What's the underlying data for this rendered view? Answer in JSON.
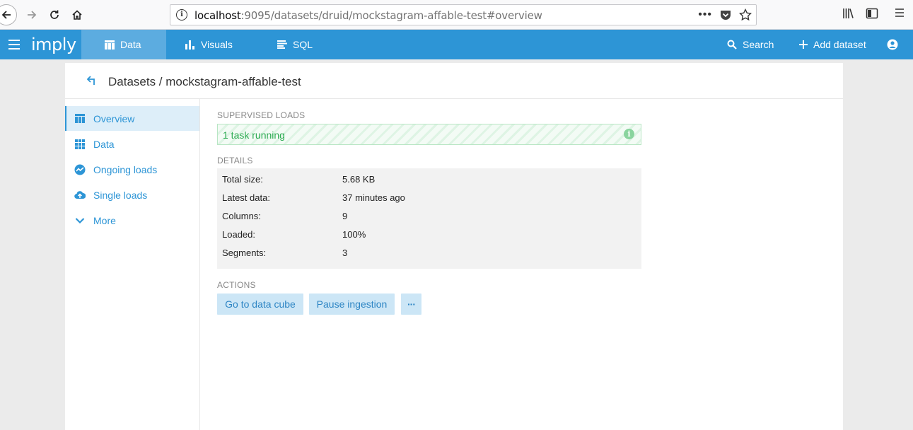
{
  "browser": {
    "url_host": "localhost",
    "url_path": ":9095/datasets/druid/mockstagram-affable-test#overview",
    "info_glyph": "i"
  },
  "header": {
    "logo": "imply",
    "tabs": [
      {
        "label": "Data",
        "icon": "table-icon",
        "active": true
      },
      {
        "label": "Visuals",
        "icon": "bar-chart-icon",
        "active": false
      },
      {
        "label": "SQL",
        "icon": "sql-icon",
        "active": false
      }
    ],
    "search_label": "Search",
    "add_dataset_label": "Add dataset",
    "colors": {
      "bar": "#2d95d6",
      "active_tab": "#5cace0"
    }
  },
  "page": {
    "breadcrumb": "Datasets / mockstagram-affable-test"
  },
  "sidebar": {
    "items": [
      {
        "label": "Overview",
        "icon": "table-icon",
        "active": true
      },
      {
        "label": "Data",
        "icon": "grid-icon",
        "active": false
      },
      {
        "label": "Ongoing loads",
        "icon": "pulse-icon",
        "active": false
      },
      {
        "label": "Single loads",
        "icon": "cloud-upload-icon",
        "active": false
      },
      {
        "label": "More",
        "icon": "chevron-down-icon",
        "active": false
      }
    ]
  },
  "supervised": {
    "label": "SUPERVISED LOADS",
    "status": "1 task running",
    "info_glyph": "i",
    "status_color": "#2dab52"
  },
  "details": {
    "label": "DETAILS",
    "rows": [
      {
        "key": "Total size:",
        "value": "5.68 KB"
      },
      {
        "key": "Latest data:",
        "value": "37 minutes ago"
      },
      {
        "key": "Columns:",
        "value": "9"
      },
      {
        "key": "Loaded:",
        "value": "100%"
      },
      {
        "key": "Segments:",
        "value": "3"
      }
    ]
  },
  "actions": {
    "label": "ACTIONS",
    "go_to_cube": "Go to data cube",
    "pause": "Pause ingestion",
    "more": "···"
  }
}
